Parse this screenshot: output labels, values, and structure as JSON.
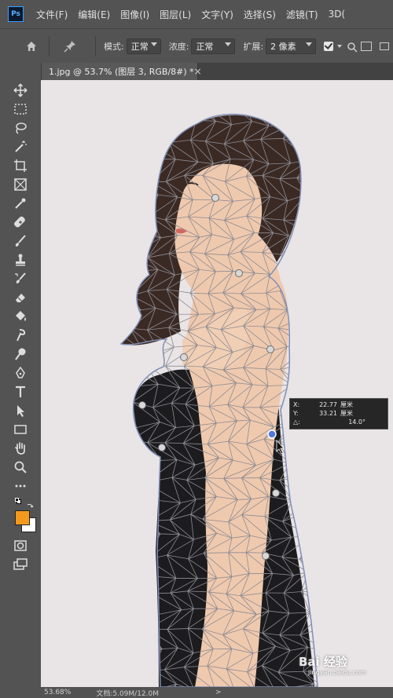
{
  "app": {
    "logo": "Ps"
  },
  "menu": [
    "文件(F)",
    "编辑(E)",
    "图像(I)",
    "图层(L)",
    "文字(Y)",
    "选择(S)",
    "滤镜(T)",
    "3D("
  ],
  "options": {
    "mode_label": "模式:",
    "mode_value": "正常",
    "density_label": "浓度:",
    "density_value": "正常",
    "expand_label": "扩展:",
    "expand_value": "2 像素"
  },
  "document_tab": {
    "title": "1.jpg @ 53.7% (图层 3, RGB/8#) *",
    "close": "×"
  },
  "readout": {
    "x_label": "X:",
    "x_value": "22.77",
    "x_unit": "厘米",
    "y_label": "Y:",
    "y_value": "33.21",
    "y_unit": "厘米",
    "angle_label": "△:",
    "angle_value": "14.0°"
  },
  "status": {
    "zoom": "53.68%",
    "doc_info": "文档:5.09M/12.0M",
    "nav_arrow": ">"
  },
  "watermark": {
    "brand": "Bai 经验",
    "url": "jingyan.baidu.com"
  },
  "colors": {
    "foreground": "#f39a1e",
    "background": "#ffffff",
    "canvas": "#e9e4e6",
    "ui_bg": "#535353"
  }
}
